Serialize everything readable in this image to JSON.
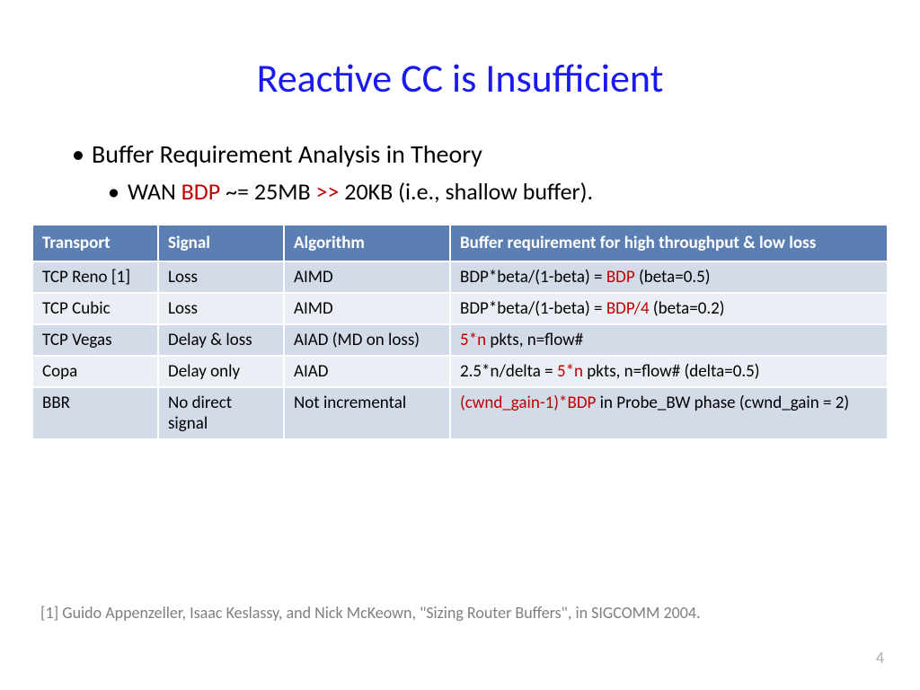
{
  "title": "Reactive CC is Insufficient",
  "bullet1": "Buffer Requirement Analysis in Theory",
  "bullet2_pre": "WAN ",
  "bullet2_bdp": "BDP",
  "bullet2_mid": " ~= 25MB ",
  "bullet2_gtgt": ">>",
  "bullet2_post": " 20KB (i.e., shallow buffer).",
  "headers": {
    "transport": "Transport",
    "signal": "Signal",
    "algorithm": "Algorithm",
    "bufreq": "Buffer requirement for high throughput & low loss"
  },
  "rows": {
    "r0": {
      "transport": "TCP Reno [1]",
      "signal": "Loss",
      "algo": "AIMD",
      "buf_pre": "BDP*beta/(1-beta) = ",
      "buf_red": "BDP",
      "buf_post": " (beta=0.5)"
    },
    "r1": {
      "transport": "TCP Cubic",
      "signal": "Loss",
      "algo": "AIMD",
      "buf_pre": "BDP*beta/(1-beta) = ",
      "buf_red": "BDP/4",
      "buf_post": " (beta=0.2)"
    },
    "r2": {
      "transport": "TCP Vegas",
      "signal": "Delay & loss",
      "algo": "AIAD (MD on loss)",
      "buf_pre": "",
      "buf_red": "5*n",
      "buf_post": " pkts, n=flow#"
    },
    "r3": {
      "transport": "Copa",
      "signal": "Delay only",
      "algo": "AIAD",
      "buf_pre": "2.5*n/delta = ",
      "buf_red": "5*n",
      "buf_post": " pkts, n=flow# (delta=0.5)"
    },
    "r4": {
      "transport": "BBR",
      "signal": "No direct signal",
      "algo": "Not incremental",
      "buf_pre": "",
      "buf_red": "(cwnd_gain-1)*BDP",
      "buf_post": " in Probe_BW phase (cwnd_gain = 2)"
    }
  },
  "footnote": "[1] Guido Appenzeller, Isaac Keslassy, and Nick McKeown, \"Sizing Router Buffers\", in SIGCOMM 2004.",
  "page_number": "4"
}
